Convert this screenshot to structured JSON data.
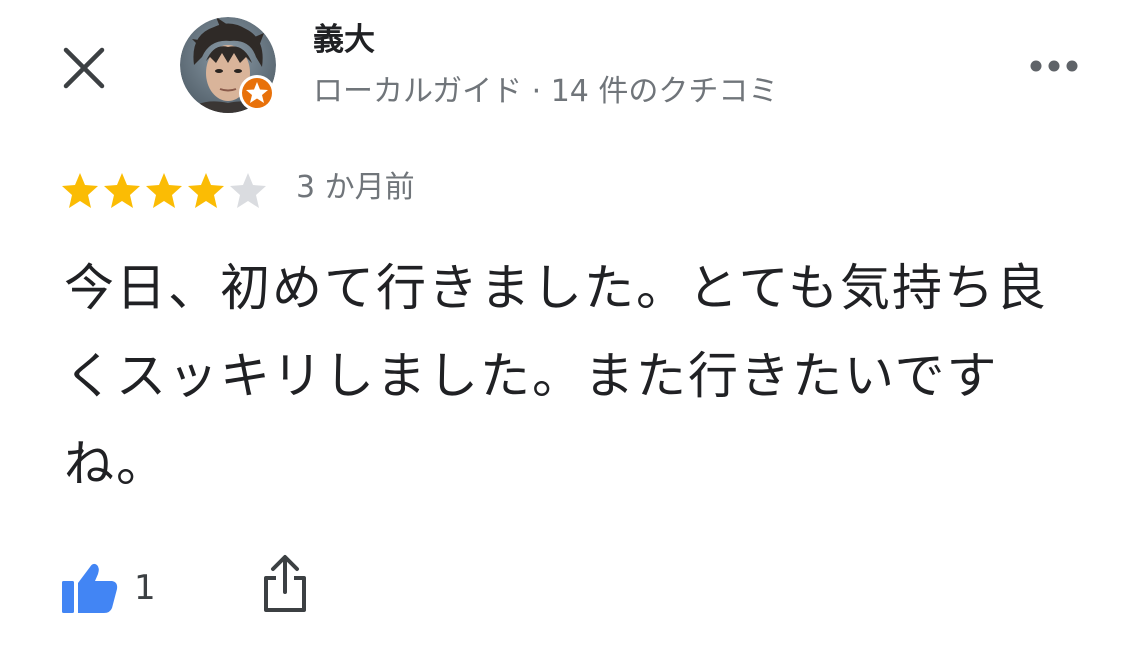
{
  "header": {
    "close_icon": "close-icon",
    "more_icon": "more-horizontal-icon"
  },
  "reviewer": {
    "name": "義大",
    "meta": "ローカルガイド · 14 件のクチコミ",
    "badge_icon": "local-guide-star-icon",
    "badge_color": "#e8710a"
  },
  "review": {
    "rating": 4,
    "max_rating": 5,
    "star_color": "#fbbc04",
    "star_empty_color": "#dadce0",
    "date": "3 か月前",
    "text": "今日、初めて行きました。とても気持ち良くスッキリしました。また行きたいですね。"
  },
  "actions": {
    "like_icon": "thumbs-up-icon",
    "like_color": "#4285f4",
    "like_count": "1",
    "share_icon": "share-icon"
  }
}
